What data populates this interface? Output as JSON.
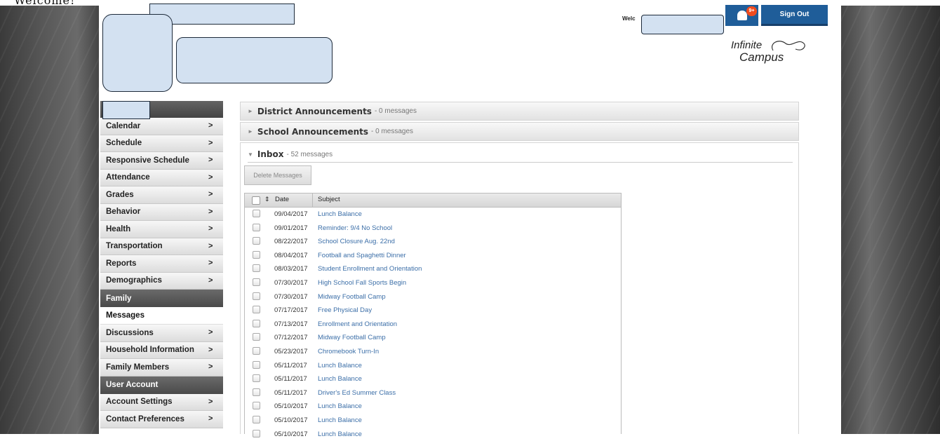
{
  "page": {
    "top_title": "Welcome!"
  },
  "header": {
    "welcome_prefix": "Welc",
    "notification_badge": "9+",
    "sign_out_label": "Sign Out",
    "logo_line1": "Infinite",
    "logo_line2": "Campus"
  },
  "sidebar": {
    "items_a": [
      {
        "label": "Calendar",
        "chevron": ">"
      },
      {
        "label": "Schedule",
        "chevron": ">"
      },
      {
        "label": "Responsive Schedule",
        "chevron": ">"
      },
      {
        "label": "Attendance",
        "chevron": ">"
      },
      {
        "label": "Grades",
        "chevron": ">"
      },
      {
        "label": "Behavior",
        "chevron": ">"
      },
      {
        "label": "Health",
        "chevron": ">"
      },
      {
        "label": "Transportation",
        "chevron": ">"
      },
      {
        "label": "Reports",
        "chevron": ">"
      },
      {
        "label": "Demographics",
        "chevron": ">"
      }
    ],
    "family_section": "Family",
    "messages_active": "Messages",
    "items_b": [
      {
        "label": "Discussions",
        "chevron": ">"
      },
      {
        "label": "Household Information",
        "chevron": ">"
      },
      {
        "label": "Family Members",
        "chevron": ">"
      }
    ],
    "user_section": "User Account",
    "items_c": [
      {
        "label": "Account Settings",
        "chevron": ">"
      },
      {
        "label": "Contact Preferences",
        "chevron": ">"
      }
    ]
  },
  "panels": {
    "district_title": "District Announcements",
    "district_count": "- 0 messages",
    "school_title": "School Announcements",
    "school_count": "- 0 messages",
    "inbox_title": "Inbox",
    "inbox_count": "- 52 messages"
  },
  "inbox": {
    "delete_label": "Delete Messages",
    "col_date": "Date",
    "col_subject": "Subject",
    "rows": [
      {
        "date": "09/04/2017",
        "subject": "Lunch Balance"
      },
      {
        "date": "09/01/2017",
        "subject": "Reminder: 9/4 No School"
      },
      {
        "date": "08/22/2017",
        "subject": "School Closure Aug. 22nd"
      },
      {
        "date": "08/04/2017",
        "subject": "Football and Spaghetti Dinner"
      },
      {
        "date": "08/03/2017",
        "subject": "Student Enrollment and Orientation"
      },
      {
        "date": "07/30/2017",
        "subject": "High School Fall Sports Begin"
      },
      {
        "date": "07/30/2017",
        "subject": "Midway Football Camp"
      },
      {
        "date": "07/17/2017",
        "subject": "Free Physical Day"
      },
      {
        "date": "07/13/2017",
        "subject": "Enrollment and Orientation"
      },
      {
        "date": "07/12/2017",
        "subject": "Midway Football Camp"
      },
      {
        "date": "05/23/2017",
        "subject": "Chromebook Turn-In"
      },
      {
        "date": "05/11/2017",
        "subject": "Lunch Balance"
      },
      {
        "date": "05/11/2017",
        "subject": "Lunch Balance"
      },
      {
        "date": "05/11/2017",
        "subject": "Driver's Ed Summer Class"
      },
      {
        "date": "05/10/2017",
        "subject": "Lunch Balance"
      },
      {
        "date": "05/10/2017",
        "subject": "Lunch Balance"
      },
      {
        "date": "05/10/2017",
        "subject": "Lunch Balance"
      }
    ]
  },
  "colors": {
    "accent": "#1f5d99",
    "badge": "#f04b1e",
    "link": "#3c6fa8"
  }
}
